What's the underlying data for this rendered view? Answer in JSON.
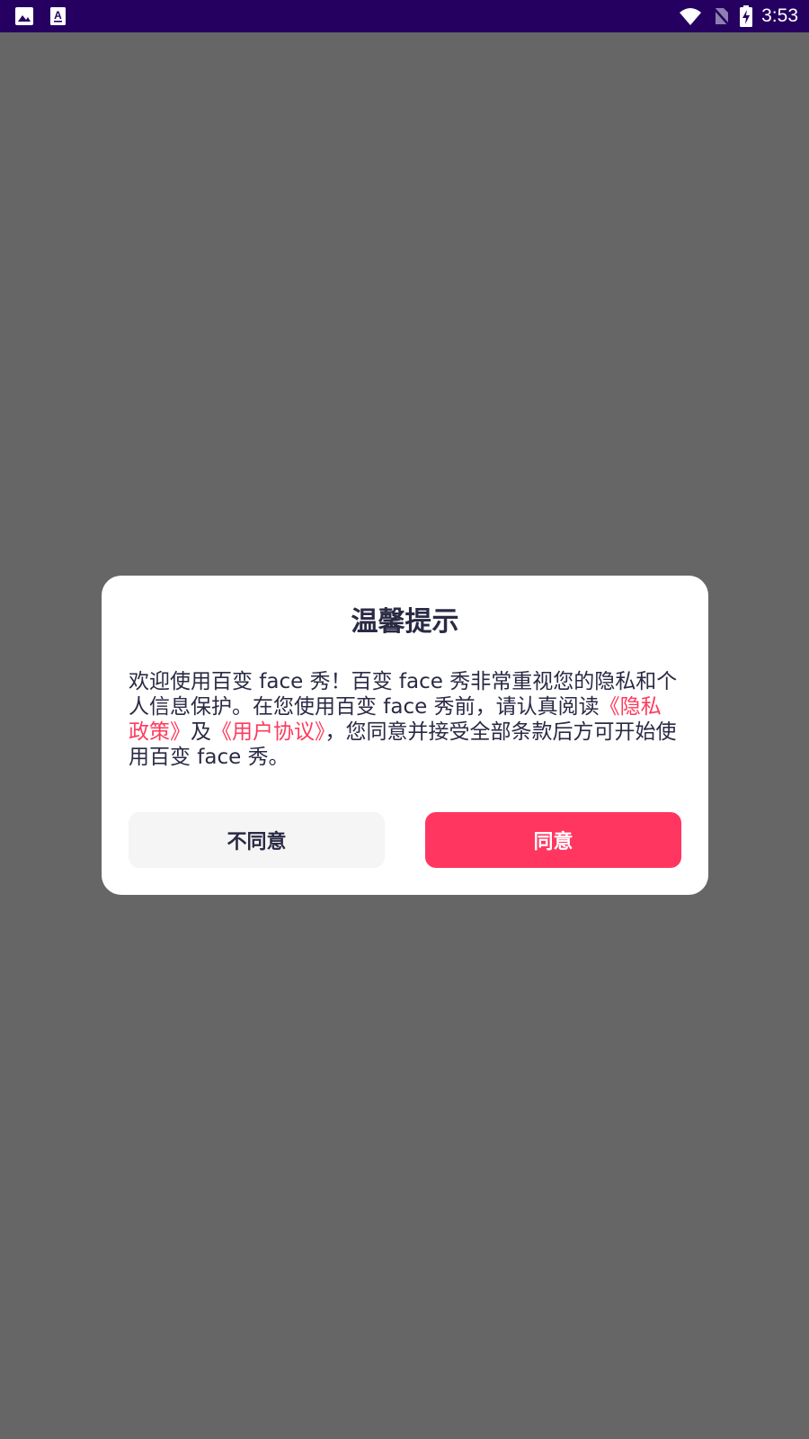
{
  "status_bar": {
    "time": "3:53",
    "background": "#250061",
    "icons_left": [
      "image-icon",
      "text-a-icon"
    ],
    "icons_right": [
      "wifi-icon",
      "no-sim-icon",
      "battery-charging-icon"
    ]
  },
  "dialog": {
    "title": "温馨提示",
    "body_parts": {
      "p1": "欢迎使用百变 face 秀！百变 face 秀非常重视您的隐私和个人信息保护。在您使用百变 face 秀前，请认真阅读",
      "privacy_link": "《隐私政策》",
      "p2": "及",
      "terms_link": "《用户协议》",
      "p3": "，您同意并接受全部条款后方可开始使用百变 face 秀。"
    },
    "buttons": {
      "disagree": "不同意",
      "agree": "同意"
    }
  },
  "colors": {
    "overlay": "#666666",
    "accent": "#ff3660",
    "link": "#ff3a5c",
    "text": "#2a2a45"
  }
}
